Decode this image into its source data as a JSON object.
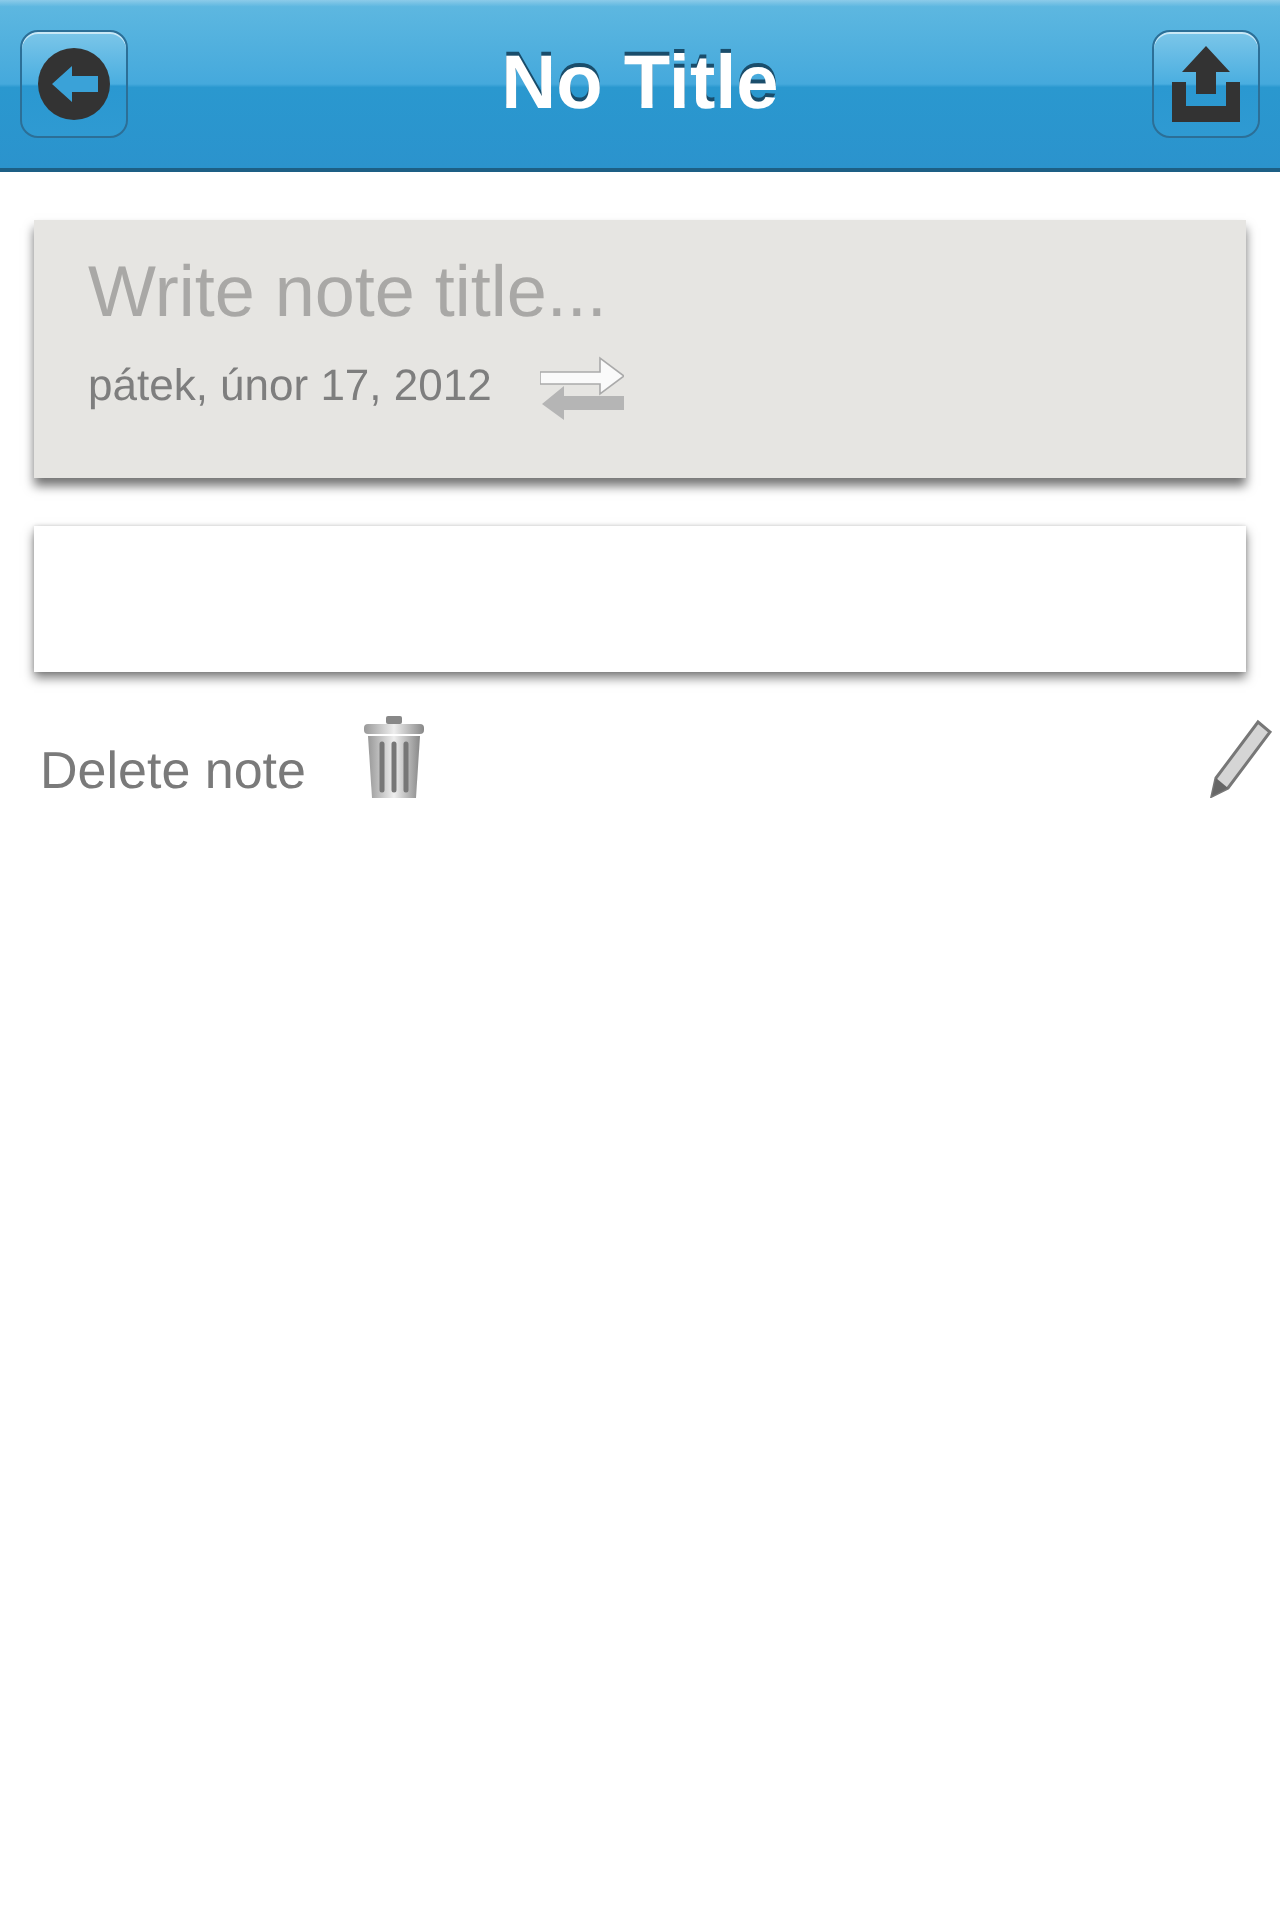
{
  "header": {
    "title": "No Title"
  },
  "note": {
    "title_placeholder": "Write note title...",
    "date": "pátek, únor 17, 2012"
  },
  "actions": {
    "delete_label": "Delete note"
  }
}
